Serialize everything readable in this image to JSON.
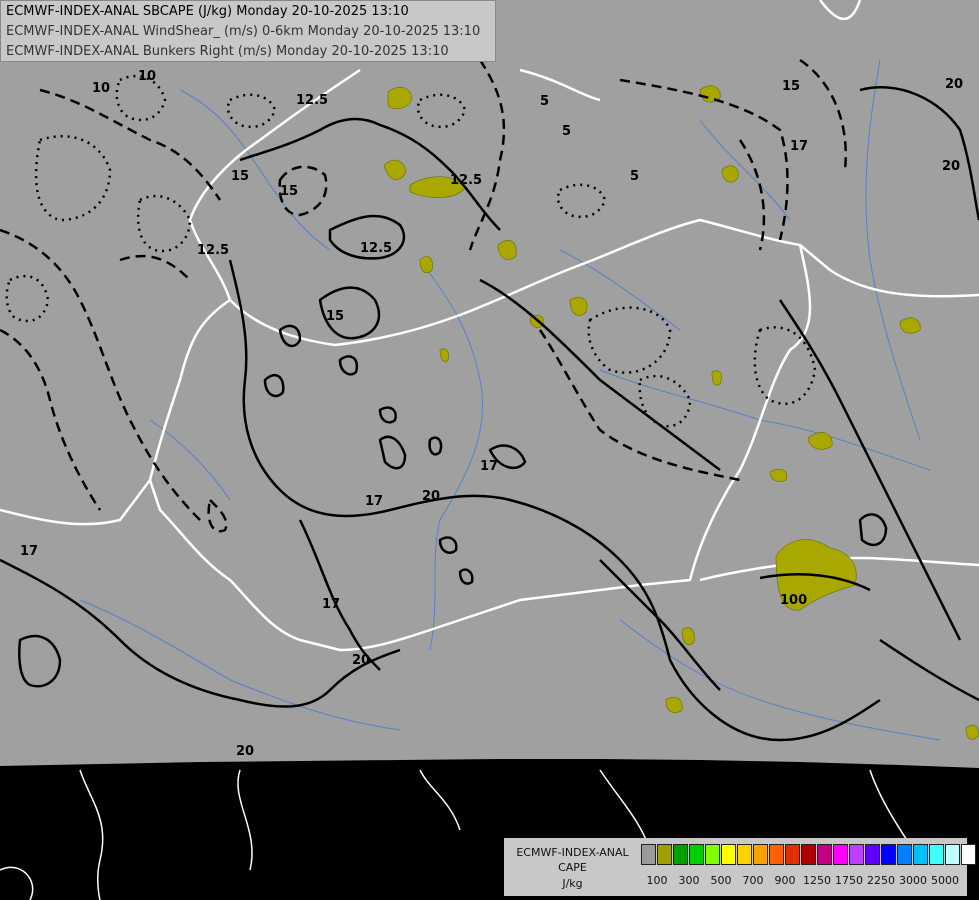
{
  "titles": {
    "line1": "ECMWF-INDEX-ANAL SBCAPE (J/kg) Monday 20-10-2025 13:10",
    "line2": "ECMWF-INDEX-ANAL WindShear_ (m/s) 0-6km Monday 20-10-2025 13:10",
    "line3": "ECMWF-INDEX-ANAL Bunkers Right (m/s) Monday 20-10-2025 13:10"
  },
  "legend": {
    "line1": "ECMWF-INDEX-ANAL",
    "line2": "CAPE",
    "line3": "J/kg",
    "colors": [
      "#9a9a9a",
      "#9ea000",
      "#00a000",
      "#00d000",
      "#7fff00",
      "#ffff00",
      "#ffd000",
      "#ffa000",
      "#ff6000",
      "#e03000",
      "#b00000",
      "#c00080",
      "#ff00ff",
      "#c040ff",
      "#6000ff",
      "#0000ff",
      "#0080ff",
      "#00c0ff",
      "#40ffff",
      "#c0ffff",
      "#ffffff"
    ],
    "ticks": [
      "100",
      "300",
      "500",
      "700",
      "900",
      "1250",
      "1750",
      "2250",
      "3000",
      "5000"
    ]
  },
  "contour_labels": [
    "10",
    "12.5",
    "15",
    "17",
    "20",
    "12.5",
    "15",
    "17",
    "20",
    "100",
    "5",
    "5",
    "5",
    "12.5",
    "17",
    "15",
    "20",
    "12.5",
    "17",
    "10",
    "15",
    "20",
    "20",
    "17"
  ],
  "colors": {
    "background": "#000000",
    "domain": "#a0a0a0",
    "cape_fill": "#a8a800",
    "borders": "#ffffff",
    "rivers": "#4a7bd0",
    "contours": "#000000"
  }
}
